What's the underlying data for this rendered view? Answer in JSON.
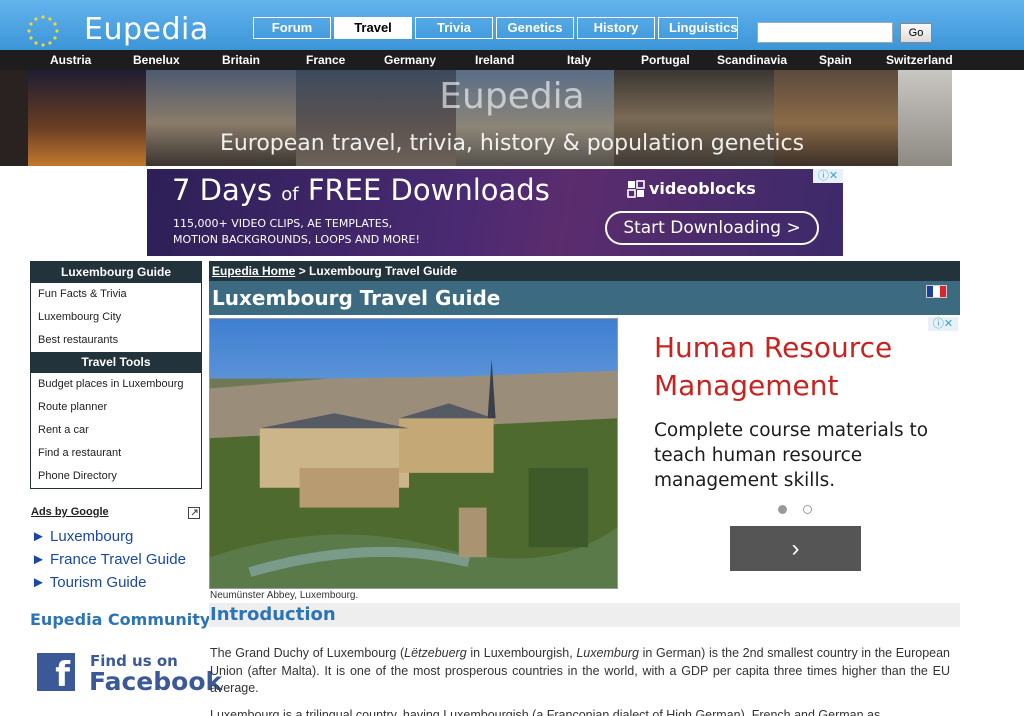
{
  "site": {
    "logo_text": "Eupedia",
    "tabs": [
      "Forum",
      "Travel",
      "Trivia",
      "Genetics",
      "History",
      "Linguistics"
    ],
    "search_placeholder": "",
    "go_label": "Go",
    "countries": [
      "Austria",
      "Benelux",
      "Britain",
      "France",
      "Germany",
      "Ireland",
      "Italy",
      "Portugal",
      "Scandinavia",
      "Spain",
      "Switzerland"
    ],
    "banner_title": "Eupedia",
    "banner_subtitle": "European travel, trivia, history & population genetics"
  },
  "top_ad": {
    "headline_big": "7 Days",
    "headline_small": "of",
    "headline_rest": "FREE Downloads",
    "line1": "115,000+ VIDEO CLIPS, AE TEMPLATES,",
    "line2": "MOTION BACKGROUNDS, LOOPS AND MORE!",
    "brand": "videoblocks",
    "cta": "Start Downloading >"
  },
  "sidebar": {
    "guide_title": "Luxembourg Guide",
    "guide_items": [
      "Fun Facts & Trivia",
      "Luxembourg City",
      "Best restaurants"
    ],
    "tools_title": "Travel Tools",
    "tools_items": [
      "Budget places in Luxembourg",
      "Route planner",
      "Rent a car",
      "Find a restaurant",
      "Phone Directory"
    ],
    "ads_label": "Ads by Google",
    "ad_links": [
      "► Luxembourg",
      "► France Travel Guide",
      "► Tourism Guide"
    ],
    "community_title": "Eupedia Community",
    "facebook_small": "Find us on",
    "facebook_big": "Facebook"
  },
  "main": {
    "breadcrumb_home": "Eupedia Home",
    "breadcrumb_sep": " > ",
    "breadcrumb_current": "Luxembourg Travel Guide",
    "page_title": "Luxembourg Travel Guide",
    "photo_caption": "Neumünster Abbey, Luxembourg.",
    "intro_heading": "Introduction",
    "para1_a": "The Grand Duchy of Luxembourg (",
    "para1_b": "Lëtzebuerg",
    "para1_c": " in Luxembourgish, ",
    "para1_d": "Luxemburg",
    "para1_e": " in German) is the 2nd smallest country in the European Union (after Malta). It is one of the most prosperous countries in the world, with a GDP per capita three times higher than the EU average.",
    "para2": "Luxembourg is a trilingual country, having Luxembourgish (a Franconian dialect of High German), French and German as"
  },
  "side_ad": {
    "title": "Human Resource Management",
    "body": "Complete course materials to teach human resource management skills.",
    "button_glyph": "›"
  },
  "colors": {
    "header_blue": "#3c95d8",
    "dark_bar": "#23333b",
    "title_bar": "#3c6a80",
    "link_blue": "#2d74b7",
    "ad_red": "#c8231f"
  }
}
